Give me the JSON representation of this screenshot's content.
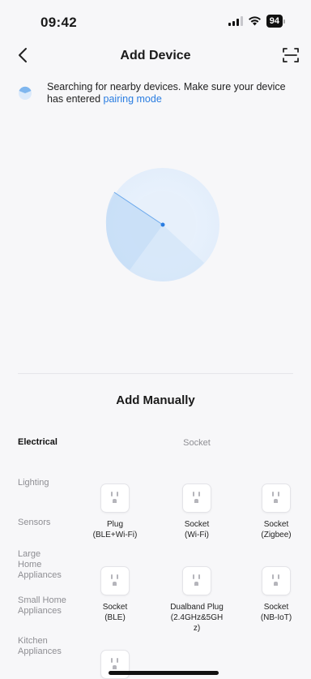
{
  "status": {
    "time": "09:42",
    "battery": "94"
  },
  "nav": {
    "title": "Add Device"
  },
  "search": {
    "text": "Searching for nearby devices. Make sure your device has entered",
    "link": "pairing mode"
  },
  "manual": {
    "title": "Add Manually",
    "subcategory": "Socket"
  },
  "categories": [
    {
      "label": "Electrical",
      "active": true
    },
    {
      "label": "Lighting"
    },
    {
      "label": "Sensors"
    },
    {
      "label": "Large Home Appliances"
    },
    {
      "label": "Small Home Appliances"
    },
    {
      "label": "Kitchen Appliances"
    }
  ],
  "devices": [
    {
      "name": "Plug\n(BLE+Wi-Fi)"
    },
    {
      "name": "Socket\n(Wi-Fi)"
    },
    {
      "name": "Socket\n(Zigbee)"
    },
    {
      "name": "Socket\n(BLE)"
    },
    {
      "name": "Dualband Plug\n(2.4GHz&5GH\nz)"
    },
    {
      "name": "Socket\n(NB-IoT)"
    },
    {
      "name": ""
    }
  ],
  "colors": {
    "accent": "#2a7de1",
    "radar": "#dbeafb",
    "radar_sweep": "#9ec8f2"
  }
}
